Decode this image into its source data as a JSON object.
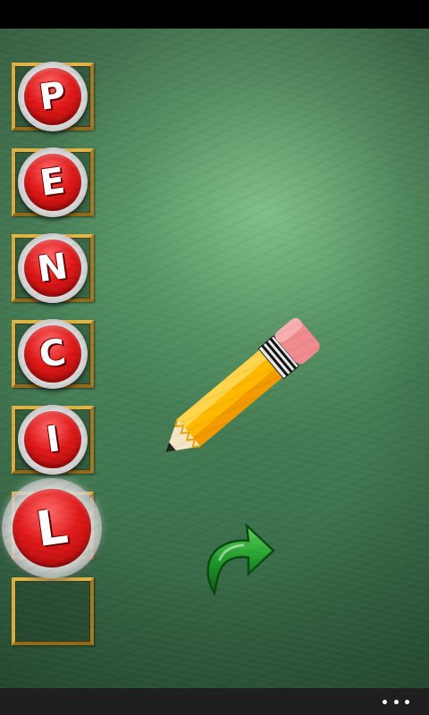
{
  "game": {
    "target_word": "PENCIL",
    "letter_tiles": [
      {
        "letter": "P",
        "state": "placed"
      },
      {
        "letter": "E",
        "state": "placed"
      },
      {
        "letter": "N",
        "state": "placed"
      },
      {
        "letter": "C",
        "state": "placed"
      },
      {
        "letter": "I",
        "state": "placed"
      },
      {
        "letter": "L",
        "state": "selected"
      }
    ],
    "slot_count": 7,
    "picture": "pencil",
    "next_button_icon": "curved-arrow-right-icon"
  },
  "app_bar": {
    "menu_icon": "ellipsis-icon"
  },
  "colors": {
    "board_green": "#4e8a5d",
    "tile_red": "#e01818",
    "frame_gold": "#c99a2e",
    "arrow_green": "#1f9a2a"
  }
}
